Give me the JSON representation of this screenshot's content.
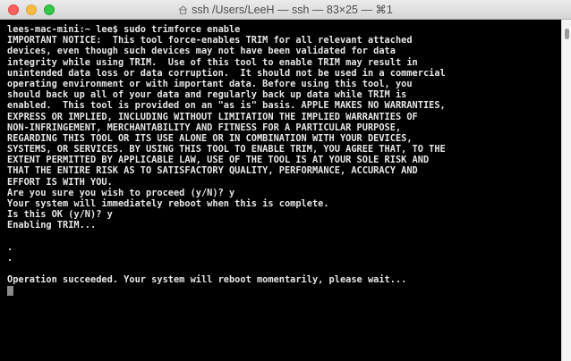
{
  "window": {
    "title": "ssh  /Users/LeeH — ssh — 83×25 — ⌘1"
  },
  "terminal": {
    "lines": [
      "lees-mac-mini:~ lee$ sudo trimforce enable",
      "IMPORTANT NOTICE:  This tool force-enables TRIM for all relevant attached",
      "devices, even though such devices may not have been validated for data",
      "integrity while using TRIM.  Use of this tool to enable TRIM may result in",
      "unintended data loss or data corruption.  It should not be used in a commercial",
      "operating environment or with important data. Before using this tool, you",
      "should back up all of your data and regularly back up data while TRIM is",
      "enabled.  This tool is provided on an \"as is\" basis. APPLE MAKES NO WARRANTIES,",
      "EXPRESS OR IMPLIED, INCLUDING WITHOUT LIMITATION THE IMPLIED WARRANTIES OF",
      "NON-INFRINGEMENT, MERCHANTABILITY AND FITNESS FOR A PARTICULAR PURPOSE,",
      "REGARDING THIS TOOL OR ITS USE ALONE OR IN COMBINATION WITH YOUR DEVICES,",
      "SYSTEMS, OR SERVICES. BY USING THIS TOOL TO ENABLE TRIM, YOU AGREE THAT, TO THE",
      "EXTENT PERMITTED BY APPLICABLE LAW, USE OF THE TOOL IS AT YOUR SOLE RISK AND",
      "THAT THE ENTIRE RISK AS TO SATISFACTORY QUALITY, PERFORMANCE, ACCURACY AND",
      "EFFORT IS WITH YOU.",
      "Are you sure you wish to proceed (y/N)? y",
      "Your system will immediately reboot when this is complete.",
      "Is this OK (y/N)? y",
      "Enabling TRIM...",
      "",
      ".",
      ".",
      "",
      "Operation succeeded. Your system will reboot momentarily, please wait..."
    ]
  }
}
